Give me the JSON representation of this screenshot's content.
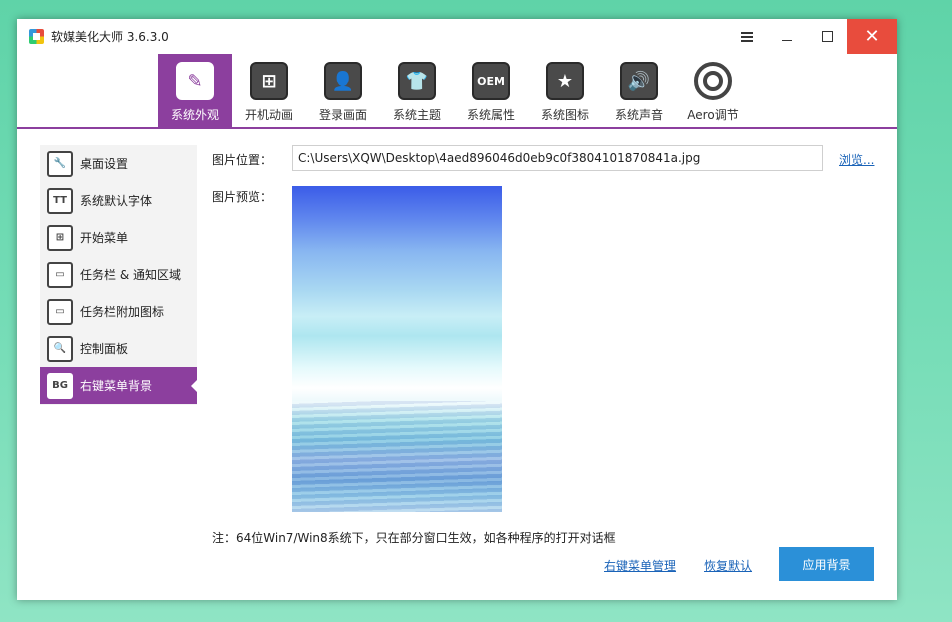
{
  "window": {
    "title": "软媒美化大师 3.6.3.0",
    "accent": "#8c3f9e"
  },
  "toolbar": {
    "items": [
      {
        "label": "系统外观",
        "icon": "paintbrush-icon",
        "glyph": "✎"
      },
      {
        "label": "开机动画",
        "icon": "windows-logo-icon",
        "glyph": "⊞"
      },
      {
        "label": "登录画面",
        "icon": "user-portrait-icon",
        "glyph": "👤"
      },
      {
        "label": "系统主题",
        "icon": "tshirt-icon",
        "glyph": "👕"
      },
      {
        "label": "系统属性",
        "icon": "oem-icon",
        "glyph": "OEM"
      },
      {
        "label": "系统图标",
        "icon": "star-icon",
        "glyph": "★"
      },
      {
        "label": "系统声音",
        "icon": "speaker-icon",
        "glyph": "🔊"
      },
      {
        "label": "Aero调节",
        "icon": "aero-ring-icon",
        "glyph": ""
      }
    ]
  },
  "sidenav": {
    "items": [
      {
        "label": "桌面设置",
        "icon": "wrench-icon",
        "glyph": "🔧"
      },
      {
        "label": "系统默认字体",
        "icon": "font-icon",
        "glyph": "TT"
      },
      {
        "label": "开始菜单",
        "icon": "start-menu-icon",
        "glyph": "⊞"
      },
      {
        "label": "任务栏 & 通知区域",
        "icon": "taskbar-icon",
        "glyph": "▭"
      },
      {
        "label": "任务栏附加图标",
        "icon": "taskbar-extra-icon",
        "glyph": "▭"
      },
      {
        "label": "控制面板",
        "icon": "magnifier-icon",
        "glyph": "🔍"
      },
      {
        "label": "右键菜单背景",
        "icon": "bg-icon",
        "glyph": "BG"
      }
    ]
  },
  "content": {
    "path_label": "图片位置：",
    "path_value": "C:\\Users\\XQW\\Desktop\\4aed896046d0eb9c0f3804101870841a.jpg",
    "browse_label": "浏览...",
    "preview_label": "图片预览：",
    "note": "注：64位Win7/Win8系统下，只在部分窗口生效，如各种程序的打开对话框",
    "manage_link": "右键菜单管理",
    "restore_link": "恢复默认",
    "apply_label": "应用背景"
  }
}
